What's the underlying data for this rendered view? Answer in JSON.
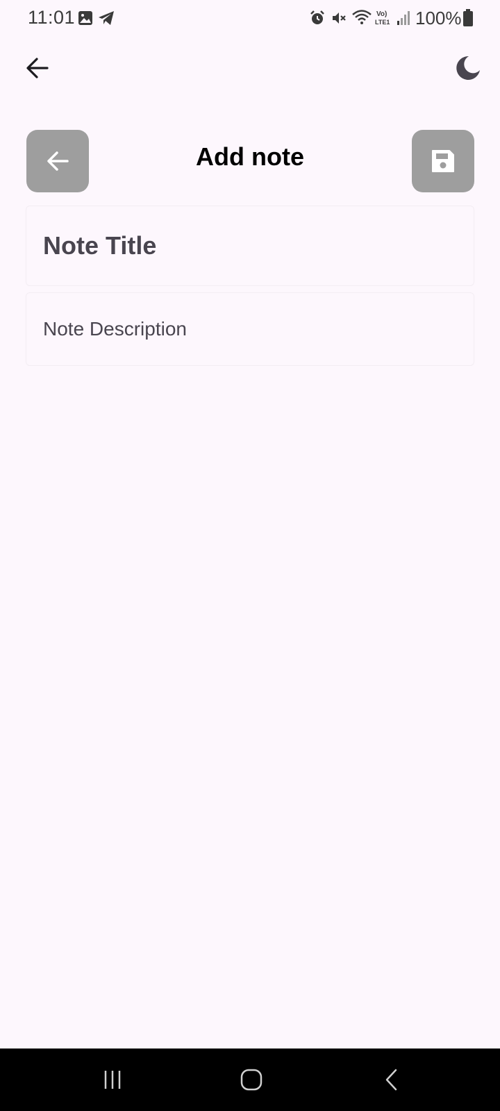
{
  "status_bar": {
    "time": "11:01",
    "battery": "100%",
    "icons": [
      "gallery-icon",
      "telegram-icon",
      "alarm-icon",
      "mute-icon",
      "wifi-icon",
      "volte-icon",
      "signal-icon",
      "battery-icon"
    ]
  },
  "app_bar": {
    "back_icon": "arrow-left-icon",
    "theme_icon": "moon-icon"
  },
  "header": {
    "title": "Add note",
    "back_button_icon": "arrow-left-icon",
    "save_button_icon": "save-icon",
    "button_color": "#9e9e9e"
  },
  "form": {
    "title_placeholder": "Note Title",
    "title_value": "",
    "description_placeholder": "Note Description",
    "description_value": ""
  },
  "nav_bar": {
    "items": [
      "recents-icon",
      "home-icon",
      "back-icon"
    ]
  },
  "colors": {
    "background": "#fdf7fd",
    "text": "#000000",
    "placeholder": "#49454f"
  }
}
